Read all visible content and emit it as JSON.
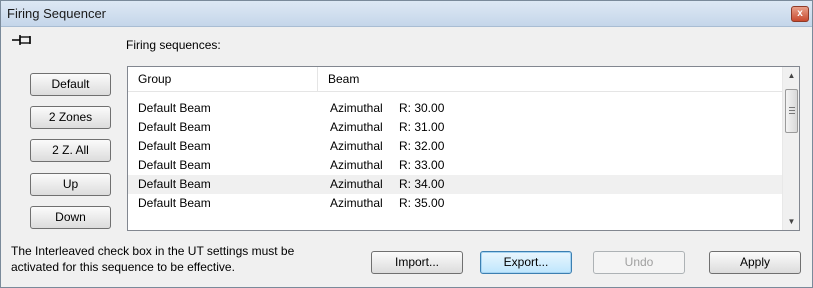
{
  "window": {
    "title": "Firing Sequencer",
    "close_glyph": "x"
  },
  "sequences_label": "Firing sequences:",
  "side_buttons": {
    "default": "Default",
    "zones2": "2 Zones",
    "z2all": "2 Z. All",
    "up": "Up",
    "down": "Down"
  },
  "table": {
    "columns": [
      "Group",
      "Beam"
    ],
    "rows": [
      {
        "group": "Default Beam",
        "beam": "Azimuthal",
        "r": "R: 30.00"
      },
      {
        "group": "Default Beam",
        "beam": "Azimuthal",
        "r": "R: 31.00"
      },
      {
        "group": "Default Beam",
        "beam": "Azimuthal",
        "r": "R: 32.00"
      },
      {
        "group": "Default Beam",
        "beam": "Azimuthal",
        "r": "R: 33.00"
      },
      {
        "group": "Default Beam",
        "beam": "Azimuthal",
        "r": "R: 34.00"
      },
      {
        "group": "Default Beam",
        "beam": "Azimuthal",
        "r": "R: 35.00"
      }
    ],
    "selected_row": 4
  },
  "note": {
    "line1": "The Interleaved check box in the UT settings must be",
    "line2": "activated for this sequence to be effective."
  },
  "bottom_buttons": {
    "import": "Import...",
    "export": "Export...",
    "undo": "Undo",
    "apply": "Apply"
  },
  "icons": {
    "pin": "pin-icon",
    "scroll_up": "scroll-up-arrow-icon",
    "scroll_down": "scroll-down-arrow-icon"
  }
}
